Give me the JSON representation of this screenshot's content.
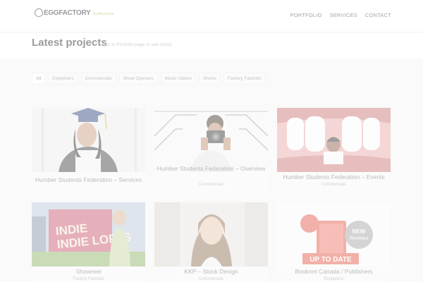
{
  "header": {
    "logo_text": "EGGFACTORY",
    "logo_tagline": "Quality pixels",
    "nav": [
      "PORTFOLIO",
      "SERVICES",
      "CONTACT"
    ]
  },
  "section": {
    "title": "Latest projects",
    "subtitle": "(go to Portfolio page to see more)"
  },
  "filters": [
    "All",
    "Explainers",
    "Commercials",
    "Show Openers",
    "Music Videos",
    "Shorts",
    "Factory Factoids"
  ],
  "projects": [
    {
      "name": "Humber Students Federation – Services",
      "category": ""
    },
    {
      "name": "Humber Students Federation – Overview",
      "category": "Commercials"
    },
    {
      "name": "Humber Students Federation – Events",
      "category": "Commercials"
    },
    {
      "name": "Showreel",
      "category": "Factory Factoids",
      "thumb_text": "INDIE LOFTS"
    },
    {
      "name": "KKP – Stock Design",
      "category": "Commercials"
    },
    {
      "name": "Booknet Canada / Publishers",
      "category": "Explainers",
      "thumb_text": "UP TO DATE",
      "badge": "NEW Reviews"
    }
  ],
  "colors": {
    "accent": "#8bb63e",
    "background": "#f3f3f3"
  }
}
